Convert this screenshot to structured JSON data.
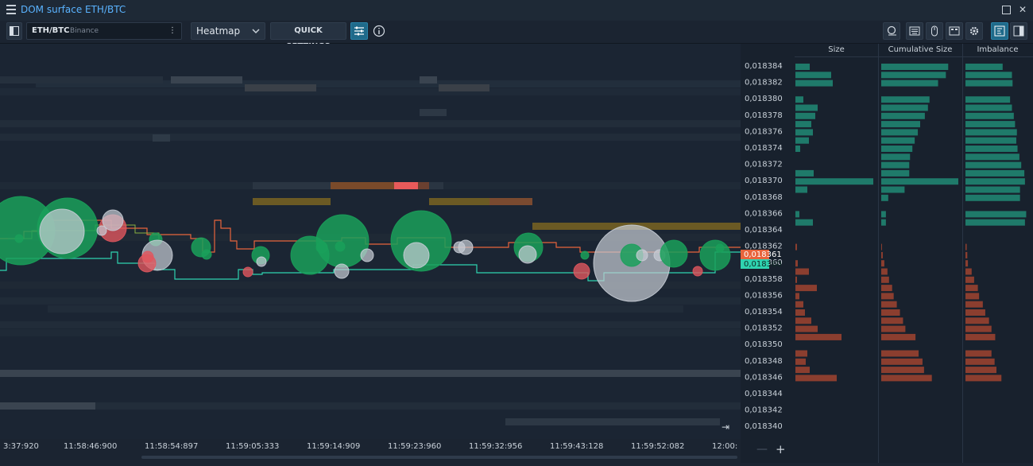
{
  "window": {
    "title": "DOM surface ETH/BTC"
  },
  "toolbar": {
    "symbol": "ETH/BTC",
    "exchange": "Binance",
    "view_mode": "Heatmap",
    "quick_settings_label": "QUICK SETTINGS"
  },
  "panel": {
    "columns": [
      "Size",
      "Cumulative Size",
      "Imbalance"
    ]
  },
  "price_axis": {
    "labels": [
      "0,018384",
      "0,018382",
      "0,018380",
      "0,018378",
      "0,018376",
      "0,018374",
      "0,018372",
      "0,018370",
      "0,018368",
      "0,018366",
      "0,018364",
      "0,018362",
      "0,018360",
      "0,018358",
      "0,018356",
      "0,018354",
      "0,018352",
      "0,018350",
      "0,018348",
      "0,018346",
      "0,018344",
      "0,018342",
      "0,018340"
    ],
    "ask_price": "0,018361",
    "bid_price": "0,018360"
  },
  "time_axis": {
    "labels": [
      "3:37:920",
      "11:58:46:900",
      "11:58:54:897",
      "11:59:05:333",
      "11:59:14:909",
      "11:59:23:960",
      "11:59:32:956",
      "11:59:43:128",
      "11:59:52:082",
      "12:00:"
    ]
  },
  "colors": {
    "ask": "#e8643c",
    "bid": "#2fd3b0",
    "buy_bubble": "#1aa05a",
    "sell_bubble": "#e0565e",
    "neutral_bubble": "#c8cdd6",
    "ask_bar": "#8b3e2f",
    "bid_bar": "#1f7a6a"
  },
  "depth": {
    "size": [
      0.18,
      0.45,
      0.47,
      0,
      0.1,
      0.28,
      0.25,
      0.2,
      0.22,
      0.17,
      0.06,
      0,
      0,
      0.23,
      0.98,
      0.15,
      0,
      0,
      0.05,
      0.22,
      0,
      0,
      0.02,
      0,
      0.03,
      0.17,
      0.02,
      0.27,
      0.05,
      0.1,
      0.12,
      0.2,
      0.28,
      0.58,
      0,
      0.15,
      0.13,
      0.18,
      0.52
    ],
    "cumulative": [
      0.86,
      0.83,
      0.73,
      0,
      0.62,
      0.6,
      0.56,
      0.5,
      0.47,
      0.43,
      0.4,
      0.37,
      0.36,
      0.36,
      0.99,
      0.3,
      0.09,
      0,
      0.06,
      0.06,
      0,
      0,
      0.01,
      0.02,
      0.04,
      0.08,
      0.1,
      0.14,
      0.16,
      0.2,
      0.24,
      0.28,
      0.31,
      0.44,
      0,
      0.48,
      0.53,
      0.55,
      0.65
    ],
    "imbalance": [
      0.6,
      0.75,
      0.76,
      0,
      0.72,
      0.75,
      0.78,
      0.8,
      0.83,
      0.82,
      0.84,
      0.87,
      0.9,
      0.95,
      0.96,
      0.88,
      0.88,
      0,
      0.98,
      0.96,
      0,
      0,
      0.02,
      0.03,
      0.04,
      0.1,
      0.14,
      0.2,
      0.22,
      0.28,
      0.32,
      0.38,
      0.42,
      0.48,
      0,
      0.42,
      0.47,
      0.5,
      0.58
    ],
    "side": [
      "bid",
      "bid",
      "bid",
      "bid",
      "bid",
      "bid",
      "bid",
      "bid",
      "bid",
      "bid",
      "bid",
      "bid",
      "bid",
      "bid",
      "bid",
      "bid",
      "bid",
      "bid",
      "bid",
      "bid",
      "bid",
      "ask",
      "ask",
      "ask",
      "ask",
      "ask",
      "ask",
      "ask",
      "ask",
      "ask",
      "ask",
      "ask",
      "ask",
      "ask",
      "ask",
      "ask",
      "ask",
      "ask",
      "ask"
    ]
  }
}
